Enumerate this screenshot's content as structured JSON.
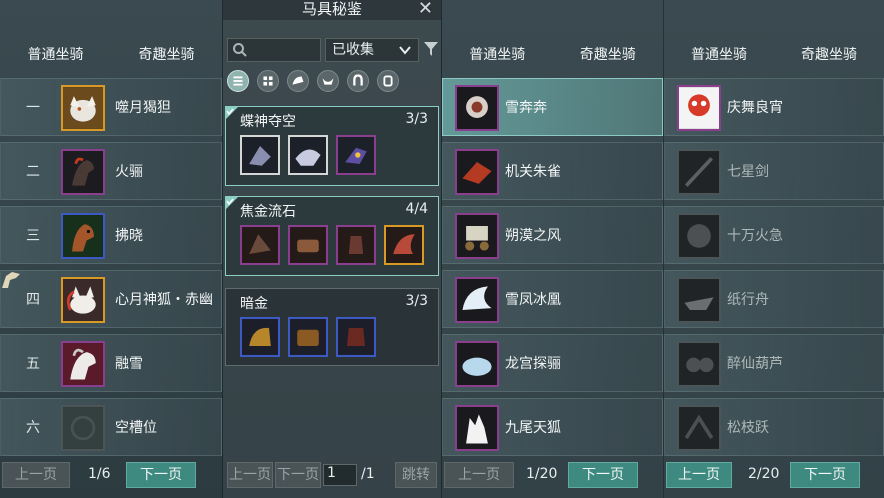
{
  "left_panel": {
    "tabs": [
      "普通坐骑",
      "奇趣坐骑"
    ],
    "rows": [
      {
        "num": "一",
        "name": "噬月猲狚",
        "frame": "gold",
        "icon": "white-wolf-mount-icon"
      },
      {
        "num": "二",
        "name": "火骊",
        "frame": "purple",
        "icon": "dark-horse-mount-icon"
      },
      {
        "num": "三",
        "name": "拂晓",
        "frame": "blue",
        "icon": "chestnut-horse-mount-icon"
      },
      {
        "num": "四",
        "name": "心月神狐・赤幽",
        "frame": "gold",
        "icon": "spirit-fox-mount-icon"
      },
      {
        "num": "五",
        "name": "融雪",
        "frame": "purple",
        "icon": "white-horse-mount-icon"
      },
      {
        "num": "六",
        "name": "空槽位",
        "frame": "gray",
        "icon": "empty-slot-icon"
      }
    ],
    "pager": {
      "prev": "上一页",
      "page": "1/6",
      "next": "下一页"
    }
  },
  "codex_panel": {
    "title": "马具秘鉴",
    "close": "✕",
    "search_placeholder": "",
    "filter_select": "已收集",
    "sets": [
      {
        "name": "蝶神夺空",
        "count": "3/3",
        "completed": true,
        "items": [
          "white",
          "white",
          "purple"
        ]
      },
      {
        "name": "焦金流石",
        "count": "4/4",
        "completed": true,
        "items": [
          "purple",
          "purple",
          "purple",
          "gold"
        ]
      },
      {
        "name": "暗金",
        "count": "3/3",
        "completed": false,
        "items": [
          "blue",
          "blue",
          "blue"
        ]
      }
    ],
    "pager": {
      "prev": "上一页",
      "next": "下一页",
      "page_value": "1",
      "total": "/1",
      "jump": "跳转"
    }
  },
  "middle_panel": {
    "tabs": [
      "普通坐骑",
      "奇趣坐骑"
    ],
    "rows": [
      {
        "name": "雪奔奔",
        "frame": "purple",
        "selected": true,
        "icon": "snow-beast-mount-icon"
      },
      {
        "name": "机关朱雀",
        "frame": "purple",
        "selected": false,
        "icon": "mech-bird-mount-icon"
      },
      {
        "name": "朔漠之风",
        "frame": "purple",
        "selected": false,
        "icon": "cart-mount-icon"
      },
      {
        "name": "雪凤冰凰",
        "frame": "purple",
        "selected": false,
        "icon": "ice-phoenix-mount-icon"
      },
      {
        "name": "龙宫探骊",
        "frame": "purple",
        "selected": false,
        "icon": "dragon-shell-mount-icon"
      },
      {
        "name": "九尾天狐",
        "frame": "purple",
        "selected": false,
        "icon": "nine-tail-fox-mount-icon"
      }
    ],
    "pager": {
      "prev": "上一页",
      "page": "1/20",
      "next": "下一页"
    }
  },
  "right_panel": {
    "tabs": [
      "普通坐骑",
      "奇趣坐骑"
    ],
    "rows": [
      {
        "name": "庆舞良宵",
        "frame": "purple",
        "dim": false,
        "icon": "lion-dance-mount-icon"
      },
      {
        "name": "七星剑",
        "frame": "gray",
        "dim": true,
        "icon": "sword-mount-icon"
      },
      {
        "name": "十万火急",
        "frame": "gray",
        "dim": true,
        "icon": "fire-orb-mount-icon"
      },
      {
        "name": "纸行舟",
        "frame": "gray",
        "dim": true,
        "icon": "paper-boat-mount-icon"
      },
      {
        "name": "醉仙葫芦",
        "frame": "gray",
        "dim": true,
        "icon": "gourd-mount-icon"
      },
      {
        "name": "松枝跃",
        "frame": "gray",
        "dim": true,
        "icon": "pine-branch-mount-icon"
      }
    ],
    "pager": {
      "prev": "上一页",
      "page": "2/20",
      "next": "下一页"
    }
  },
  "colors": {
    "accent_teal": "#3f8a80",
    "frame_purple": "#8a3e8e",
    "frame_gold": "#d99a25",
    "frame_blue": "#3d59c4",
    "completed_border": "#8ccdc4"
  }
}
